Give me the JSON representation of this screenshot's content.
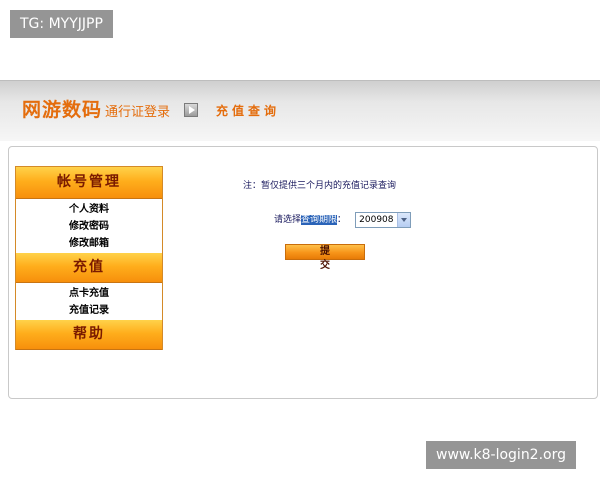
{
  "watermarks": {
    "top": "TG: MYYJJPP",
    "bottom": "www.k8-login2.org"
  },
  "header": {
    "brand": "网游数码",
    "brand_sub": "通行证登录",
    "current_page": "充值查询",
    "arrow_icon": "play-arrow-icon"
  },
  "sidebar": {
    "sections": [
      {
        "title": "帐号管理",
        "items": [
          "个人资料",
          "修改密码",
          "修改邮箱"
        ]
      },
      {
        "title": "充值",
        "items": [
          "点卡充值",
          "充值记录"
        ]
      },
      {
        "title": "帮助",
        "items": []
      }
    ]
  },
  "content": {
    "note": "注：暂仅提供三个月内的充值记录查询",
    "select_label_prefix": "请选择",
    "select_label_highlight": "查询期限",
    "select_label_suffix": "：",
    "select_value": "200908",
    "submit_label": "提交"
  },
  "colors": {
    "accent": "#e46d0d",
    "sidebar_header": "#ffae1c",
    "text_dark_blue": "#1a1a5e"
  }
}
